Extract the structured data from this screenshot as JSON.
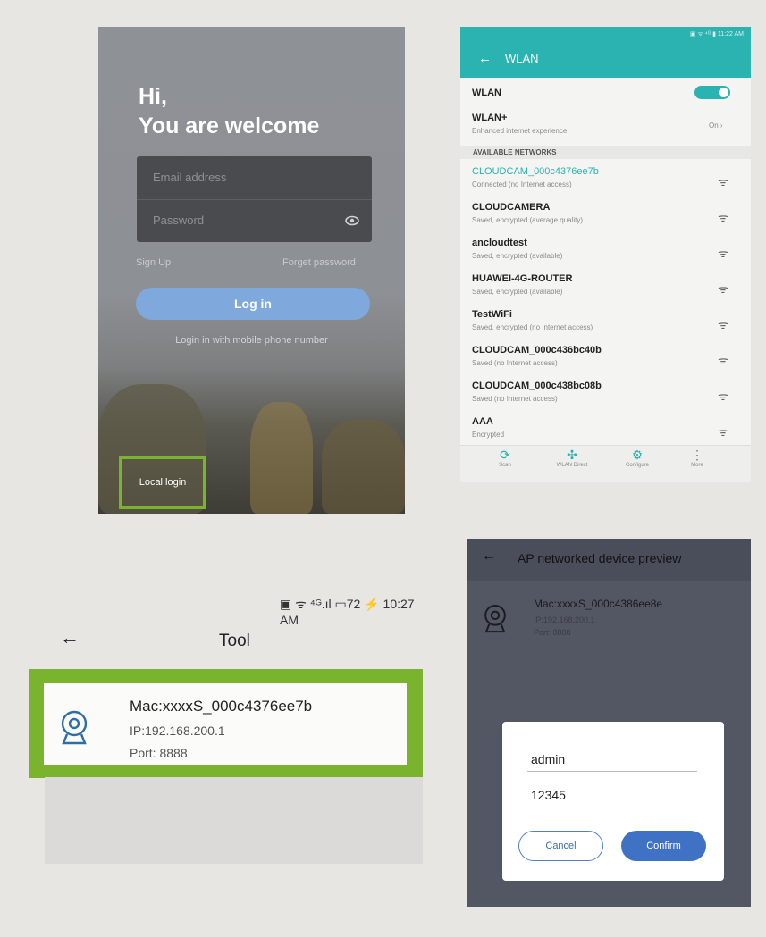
{
  "login": {
    "greeting_line1": "Hi,",
    "greeting_line2": "You are welcome",
    "email_placeholder": "Email address",
    "password_placeholder": "Password",
    "eye_icon": "eye-icon",
    "sign_up": "Sign Up",
    "forget_password": "Forget password",
    "login_button": "Log in",
    "phone_login": "Login in with mobile phone number",
    "local_login": "Local login",
    "highlight_color": "#7ab32e",
    "button_color": "#7fa8dd"
  },
  "wlan": {
    "title": "WLAN",
    "status_bar": "▣ ᯤ ⁴ᴳ ▮ 11:22 AM",
    "wlan_label": "WLAN",
    "wlan_enabled": true,
    "wlan_plus": {
      "title": "WLAN+",
      "subtitle": "Enhanced internet experience",
      "value": "On ›"
    },
    "section_title": "AVAILABLE NETWORKS",
    "accent_color": "#2ab3b0",
    "networks": [
      {
        "ssid": "CLOUDCAM_000c4376ee7b",
        "status": "Connected (no Internet access)"
      },
      {
        "ssid": "CLOUDCAMERA",
        "status": "Saved, encrypted (average quality)"
      },
      {
        "ssid": "ancloudtest",
        "status": "Saved, encrypted (available)"
      },
      {
        "ssid": "HUAWEI-4G-ROUTER",
        "status": "Saved, encrypted (available)"
      },
      {
        "ssid": "TestWiFi",
        "status": "Saved, encrypted (no Internet access)"
      },
      {
        "ssid": "CLOUDCAM_000c436bc40b",
        "status": "Saved (no Internet access)"
      },
      {
        "ssid": "CLOUDCAM_000c438bc08b",
        "status": "Saved (no Internet access)"
      },
      {
        "ssid": "AAA",
        "status": "Encrypted"
      }
    ],
    "bottom_bar": [
      {
        "icon": "scan-icon",
        "label": "Scan"
      },
      {
        "icon": "wlan-direct-icon",
        "label": "WLAN Direct"
      },
      {
        "icon": "configure-icon",
        "label": "Configure"
      },
      {
        "icon": "more-icon",
        "label": "More"
      }
    ]
  },
  "tool": {
    "status_bar": "▣ ᯤ ⁴ᴳ.ıl ▭72 ⚡ 10:27 AM",
    "title": "Tool",
    "device": {
      "mac": "Mac:xxxxS_000c4376ee7b",
      "ip": "IP:192.168.200.1",
      "port": "Port: 8888"
    },
    "highlight_color": "#7ab32e"
  },
  "ap_preview": {
    "title": "AP networked device preview",
    "device": {
      "mac": "Mac:xxxxS_000c4386ee8e",
      "ip": "IP:192.168.200.1",
      "port": "Port: 8888"
    },
    "dialog": {
      "username": "admin",
      "password": "12345",
      "cancel": "Cancel",
      "confirm": "Confirm"
    },
    "confirm_color": "#3f72c4"
  }
}
